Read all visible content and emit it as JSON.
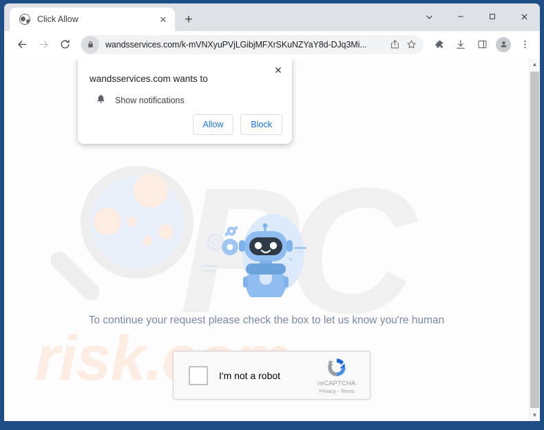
{
  "window": {
    "controls": [
      {
        "name": "tab-search",
        "glyph": "chevron-down"
      },
      {
        "name": "minimize",
        "glyph": "minus"
      },
      {
        "name": "maximize",
        "glyph": "square"
      },
      {
        "name": "close",
        "glyph": "x"
      }
    ]
  },
  "tabstrip": {
    "tab": {
      "title": "Click Allow",
      "favicon": "globe-icon",
      "close_label": "✕"
    },
    "new_tab_label": "+"
  },
  "toolbar": {
    "back_label": "←",
    "forward_label": "→",
    "reload_label": "↻",
    "url": "wandsservices.com/k-mVNXyuPVjLGibjMFXrSKuNZYaY8d-DJq3Mi...",
    "lock_icon": "lock-icon",
    "share_icon": "share-icon",
    "bookmark_icon": "star-icon",
    "extensions_icon": "puzzle-icon",
    "download_icon": "download-icon",
    "sidepanel_icon": "side-panel-icon",
    "profile_icon": "person-icon",
    "menu_icon": "three-dot-menu-icon"
  },
  "permission_dialog": {
    "title": "wandsservices.com wants to",
    "permission_label": "Show notifications",
    "permission_icon": "bell-icon",
    "allow_label": "Allow",
    "block_label": "Block",
    "close_label": "✕"
  },
  "page": {
    "headline": "To continue your request please check the box to let us know you're human",
    "watermark_letters": "PC",
    "watermark_text": "risk.com",
    "illustration": "robot-mascot-illustration",
    "recaptcha": {
      "checkbox_label": "I'm not a robot",
      "brand_name": "reCAPTCHA",
      "links": "Privacy - Terms",
      "logo": "recaptcha-logo-icon"
    }
  },
  "scrollbar": {
    "up_label": "▲",
    "down_label": "▼"
  },
  "colors": {
    "accent": "#1a73e8",
    "frame": "#1f4e87",
    "tabstrip": "#dee1e6",
    "headline": "#7a8aa3",
    "watermark_orange": "#fdece2"
  }
}
